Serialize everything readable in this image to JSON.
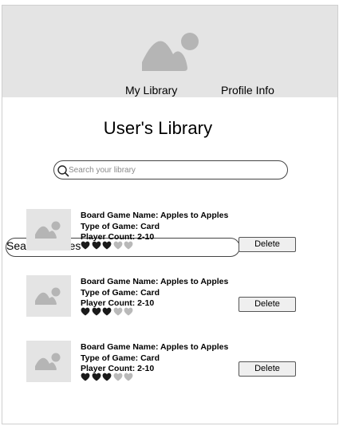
{
  "nav": {
    "items": [
      {
        "label": "Search Games"
      },
      {
        "label": "My Library"
      },
      {
        "label": "Profile Info"
      }
    ]
  },
  "page": {
    "title": "User's Library"
  },
  "search": {
    "placeholder": "Search your library",
    "value": ""
  },
  "games": [
    {
      "name": "Board Game Name: Apples to Apples",
      "type": "Type of Game: Card",
      "players": "Player Count: 2-10",
      "rating": 3,
      "rating_max": 5,
      "delete_label": "Delete"
    },
    {
      "name": "Board Game Name: Apples to Apples",
      "type": "Type of Game: Card",
      "players": "Player Count: 2-10",
      "rating": 3,
      "rating_max": 5,
      "delete_label": "Delete"
    },
    {
      "name": "Board Game Name: Apples to Apples",
      "type": "Type of Game: Card",
      "players": "Player Count: 2-10",
      "rating": 3,
      "rating_max": 5,
      "delete_label": "Delete"
    }
  ],
  "icons": {
    "header": "image-placeholder-icon",
    "search": "magnifier-icon",
    "thumbnail": "image-placeholder-icon",
    "rating": "heart-icon"
  },
  "colors": {
    "header_bg": "#e4e4e4",
    "placeholder_icon": "#b5b5b5",
    "heart_filled": "#1a1a1a",
    "heart_empty": "#b9b9b9",
    "button_bg": "#efefef"
  }
}
